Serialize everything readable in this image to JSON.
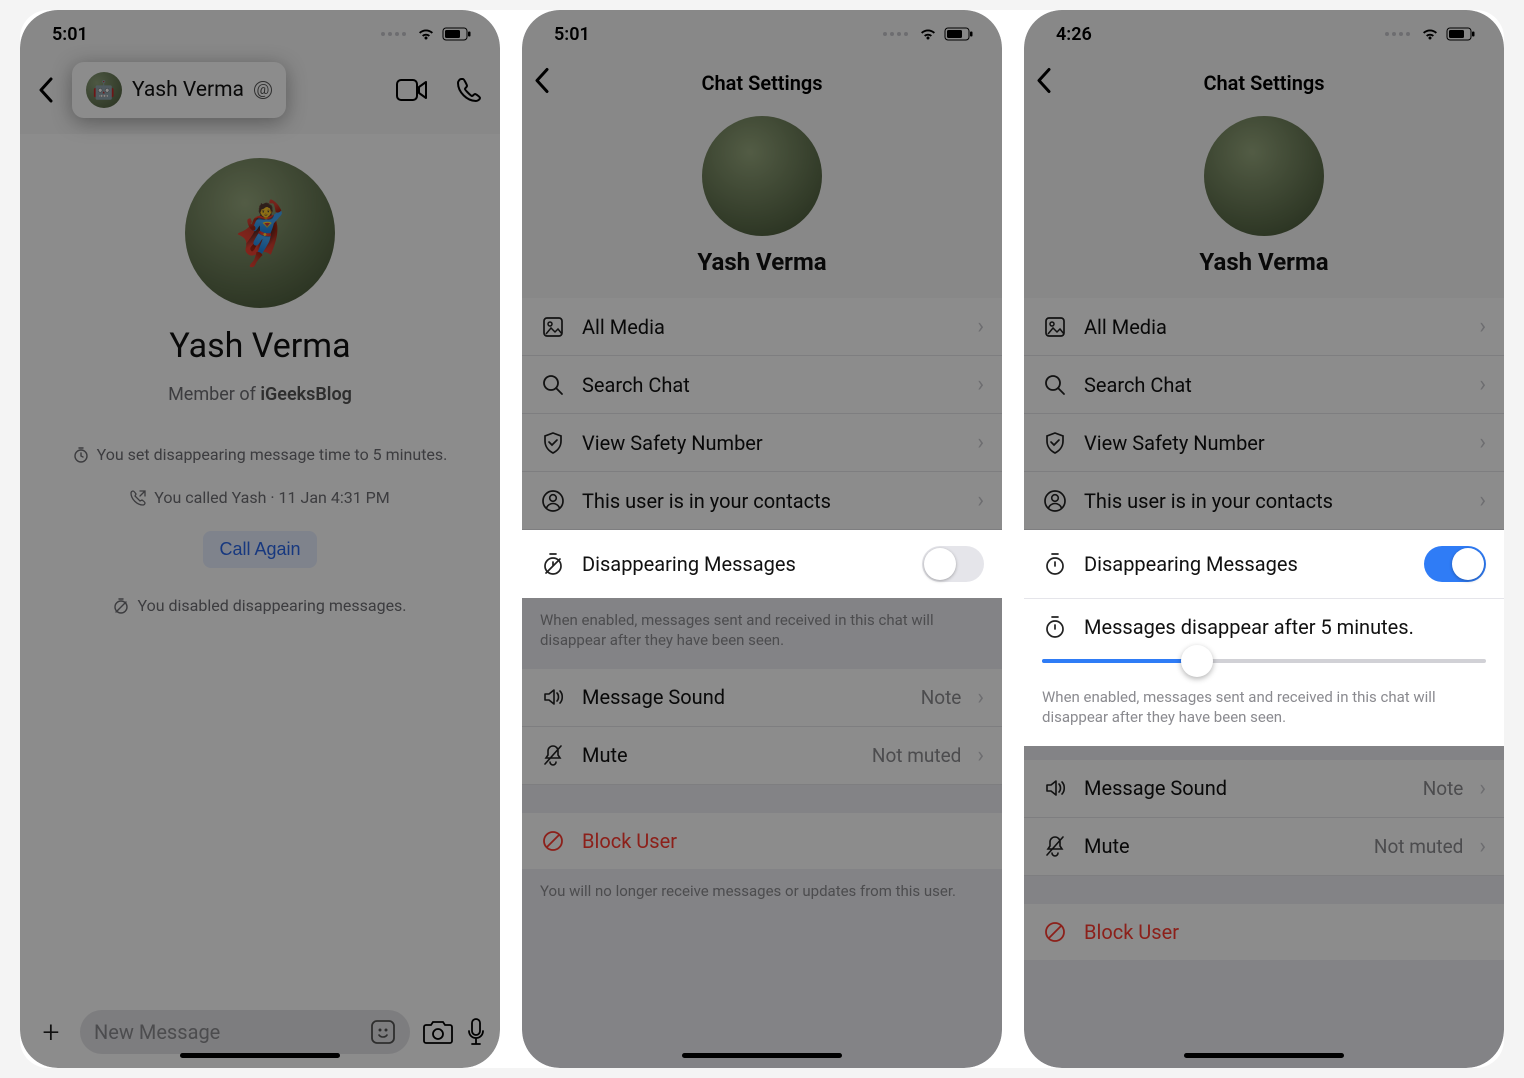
{
  "status": {
    "time1": "5:01",
    "time2": "5:01",
    "time3": "4:26"
  },
  "chat": {
    "contact_name_header": "Yash Verma",
    "contact_name": "Yash Verma",
    "member_prefix": "Member of ",
    "member_group": "iGeeksBlog",
    "sys_set_timer": "You set disappearing message time to 5 minutes.",
    "sys_called": "You called Yash · 11 Jan 4:31 PM",
    "call_again": "Call Again",
    "sys_disabled": "You disabled disappearing messages.",
    "composer_placeholder": "New Message"
  },
  "settings": {
    "title": "Chat Settings",
    "profile_name": "Yash Verma",
    "all_media": "All Media",
    "search_chat": "Search Chat",
    "safety_number": "View Safety Number",
    "in_contacts": "This user is in your contacts",
    "disappearing": "Disappearing Messages",
    "disappearing_after": "Messages disappear after 5 minutes.",
    "footer": "When enabled, messages sent and received in this chat will disappear after they have been seen.",
    "sound_label": "Message Sound",
    "sound_value": "Note",
    "mute_label": "Mute",
    "mute_value": "Not muted",
    "block": "Block User",
    "block_footer": "You will no longer receive messages or updates from this user.",
    "slider_percent": 35
  }
}
